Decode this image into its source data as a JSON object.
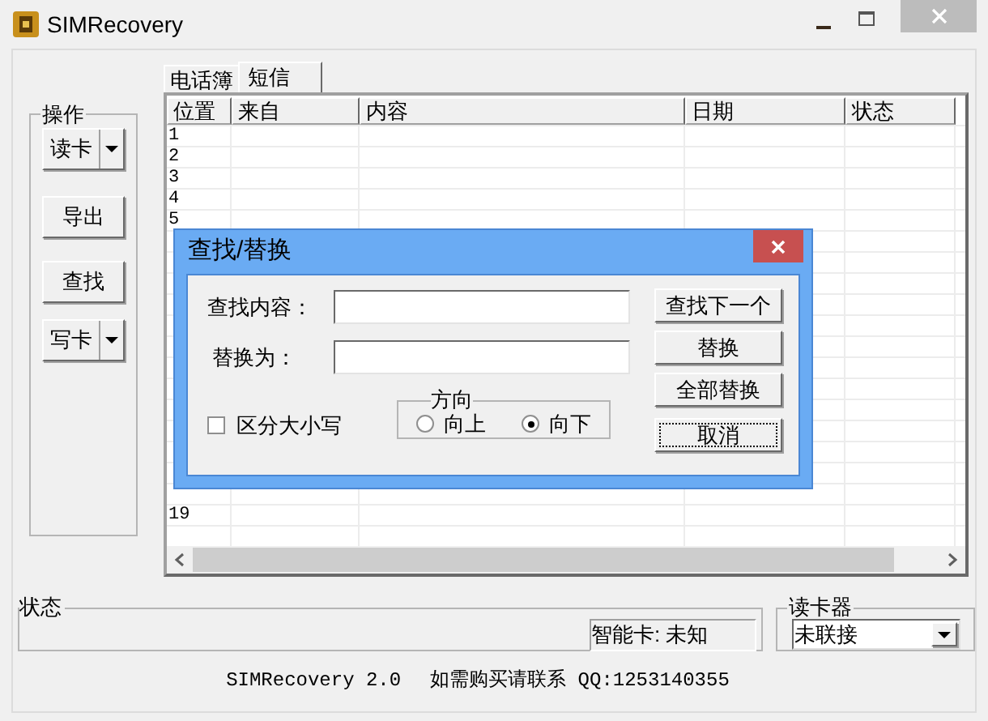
{
  "window": {
    "title": "SIMRecovery"
  },
  "operations": {
    "title": "操作",
    "buttons": [
      {
        "label": "读卡",
        "kind": "split"
      },
      {
        "label": "导出",
        "kind": "plain"
      },
      {
        "label": "查找",
        "kind": "plain"
      },
      {
        "label": "写卡",
        "kind": "split"
      }
    ]
  },
  "tabs": [
    {
      "label": "电话簿",
      "selected": false
    },
    {
      "label": "短信",
      "selected": true
    }
  ],
  "table": {
    "columns": [
      "位置",
      "来自",
      "内容",
      "日期",
      "状态"
    ],
    "rows_above": [
      "1",
      "2",
      "3",
      "4",
      "5"
    ],
    "rows_below": [
      "19"
    ]
  },
  "status": {
    "title": "状态",
    "smart_card": "智能卡: 未知"
  },
  "reader": {
    "title": "读卡器",
    "value": "未联接"
  },
  "footer": [
    "SIMRecovery 2.0",
    "如需购买请联系 QQ:1253140355"
  ],
  "dialog": {
    "title": "查找/替换",
    "find_label": "查找内容：",
    "replace_label": "替换为：",
    "match_case": {
      "label": "区分大小写",
      "checked": false
    },
    "direction": {
      "title": "方向",
      "options": [
        {
          "label": "向上",
          "selected": false
        },
        {
          "label": "向下",
          "selected": true
        }
      ]
    },
    "buttons": [
      {
        "label": "查找下一个",
        "focused": false
      },
      {
        "label": "替换",
        "focused": false
      },
      {
        "label": "全部替换",
        "focused": false
      },
      {
        "label": "取消",
        "focused": true
      }
    ]
  }
}
